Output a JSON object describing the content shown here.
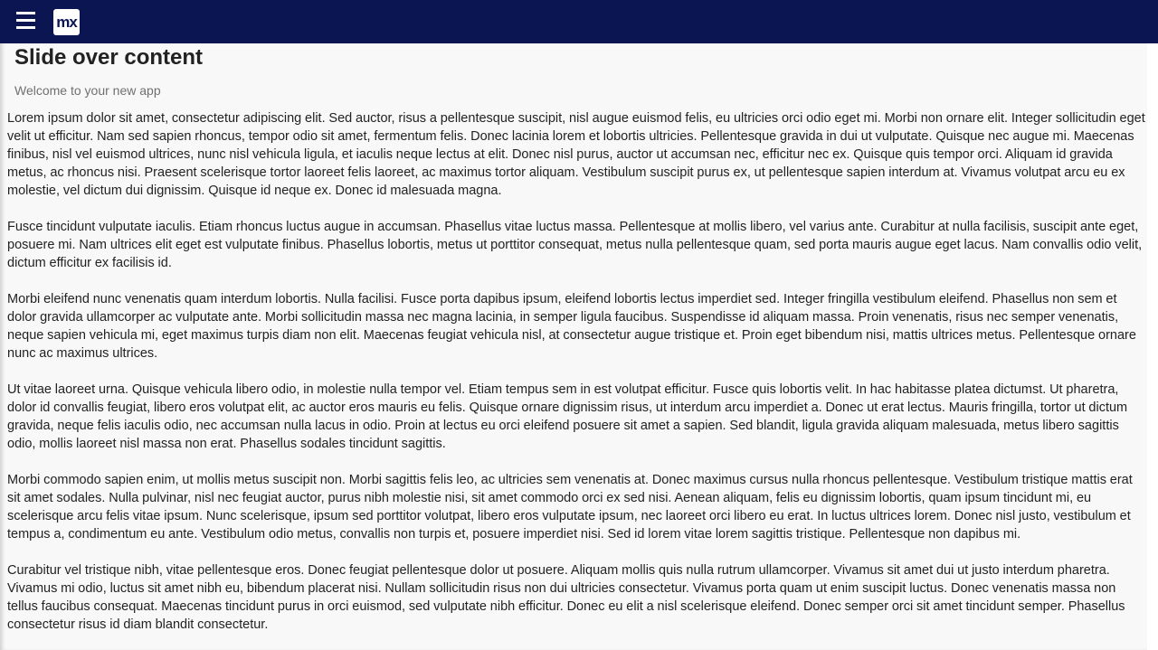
{
  "topbar": {
    "menu_icon": "hamburger-menu-icon",
    "logo_text": "mx",
    "color": "#0a1551"
  },
  "main": {
    "title": "Slide over content",
    "subtitle": "Welcome to your new app",
    "paragraphs": [
      "Lorem ipsum dolor sit amet, consectetur adipiscing elit. Sed auctor, risus a pellentesque suscipit, nisl augue euismod felis, eu ultricies orci odio eget mi. Morbi non ornare elit. Integer sollicitudin eget velit ut efficitur. Nam sed sapien rhoncus, tempor odio sit amet, fermentum felis. Donec lacinia lorem et lobortis ultricies. Pellentesque gravida in dui ut vulputate. Quisque nec augue mi. Maecenas finibus, nisl vel euismod ultrices, nunc nisl vehicula ligula, et iaculis neque lectus at elit. Donec nisl purus, auctor ut accumsan nec, efficitur nec ex. Quisque quis tempor orci. Aliquam id gravida metus, ac rhoncus nisi. Praesent scelerisque tortor laoreet felis laoreet, ac maximus tortor aliquam. Vestibulum suscipit purus ex, ut pellentesque sapien interdum at. Vivamus volutpat arcu eu ex molestie, vel dictum dui dignissim. Quisque id neque ex. Donec id malesuada magna.",
      "Fusce tincidunt vulputate iaculis. Etiam rhoncus luctus augue in accumsan. Phasellus vitae luctus massa. Pellentesque at mollis libero, vel varius ante. Curabitur at nulla facilisis, suscipit ante eget, posuere mi. Nam ultrices elit eget est vulputate finibus. Phasellus lobortis, metus ut porttitor consequat, metus nulla pellentesque quam, sed porta mauris augue eget lacus. Nam convallis odio velit, dictum efficitur ex facilisis id.",
      "Morbi eleifend nunc venenatis quam interdum lobortis. Nulla facilisi. Fusce porta dapibus ipsum, eleifend lobortis lectus imperdiet sed. Integer fringilla vestibulum eleifend. Phasellus non sem et dolor gravida ullamcorper ac vulputate ante. Morbi sollicitudin massa nec magna lacinia, in semper ligula faucibus. Suspendisse id aliquam massa. Proin venenatis, risus nec semper venenatis, neque sapien vehicula mi, eget maximus turpis diam non elit. Maecenas feugiat vehicula nisl, at consectetur augue tristique et. Proin eget bibendum nisi, mattis ultrices metus. Pellentesque ornare nunc ac maximus ultrices.",
      "Ut vitae laoreet urna. Quisque vehicula libero odio, in molestie nulla tempor vel. Etiam tempus sem in est volutpat efficitur. Fusce quis lobortis velit. In hac habitasse platea dictumst. Ut pharetra, dolor id convallis feugiat, libero eros volutpat elit, ac auctor eros mauris eu felis. Quisque ornare dignissim risus, ut interdum arcu imperdiet a. Donec ut erat lectus. Mauris fringilla, tortor ut dictum gravida, neque felis iaculis odio, nec accumsan nulla lacus in odio. Proin at lectus eu orci eleifend posuere sit amet a sapien. Sed blandit, ligula gravida aliquam malesuada, metus libero sagittis odio, mollis laoreet nisl massa non erat. Phasellus sodales tincidunt sagittis.",
      "Morbi commodo sapien enim, ut mollis metus suscipit non. Morbi sagittis felis leo, ac ultricies sem venenatis at. Donec maximus cursus nulla rhoncus pellentesque. Vestibulum tristique mattis erat sit amet sodales. Nulla pulvinar, nisl nec feugiat auctor, purus nibh molestie nisi, sit amet commodo orci ex sed nisi. Aenean aliquam, felis eu dignissim lobortis, quam ipsum tincidunt mi, eu scelerisque arcu felis vitae ipsum. Nunc scelerisque, ipsum sed porttitor volutpat, libero eros vulputate ipsum, nec laoreet orci libero eu erat. In luctus ultrices lorem. Donec nisl justo, vestibulum et tempus a, condimentum eu ante. Vestibulum odio metus, convallis non turpis et, posuere imperdiet nisi. Sed id lorem vitae lorem sagittis tristique. Pellentesque non dapibus mi.",
      "Curabitur vel tristique nibh, vitae pellentesque eros. Donec feugiat pellentesque dolor ut posuere. Aliquam mollis quis nulla rutrum ullamcorper. Vivamus sit amet dui ut justo interdum pharetra. Vivamus mi odio, luctus sit amet nibh eu, bibendum placerat nisi. Nullam sollicitudin risus non dui ultricies consectetur. Vivamus porta quam ut enim suscipit luctus. Donec venenatis massa non tellus faucibus consequat. Maecenas tincidunt purus in orci euismod, sed vulputate nibh efficitur. Donec eu elit a nisl scelerisque eleifend. Donec semper orci sit amet tincidunt semper. Phasellus consectetur risus id diam blandit consectetur."
    ]
  }
}
